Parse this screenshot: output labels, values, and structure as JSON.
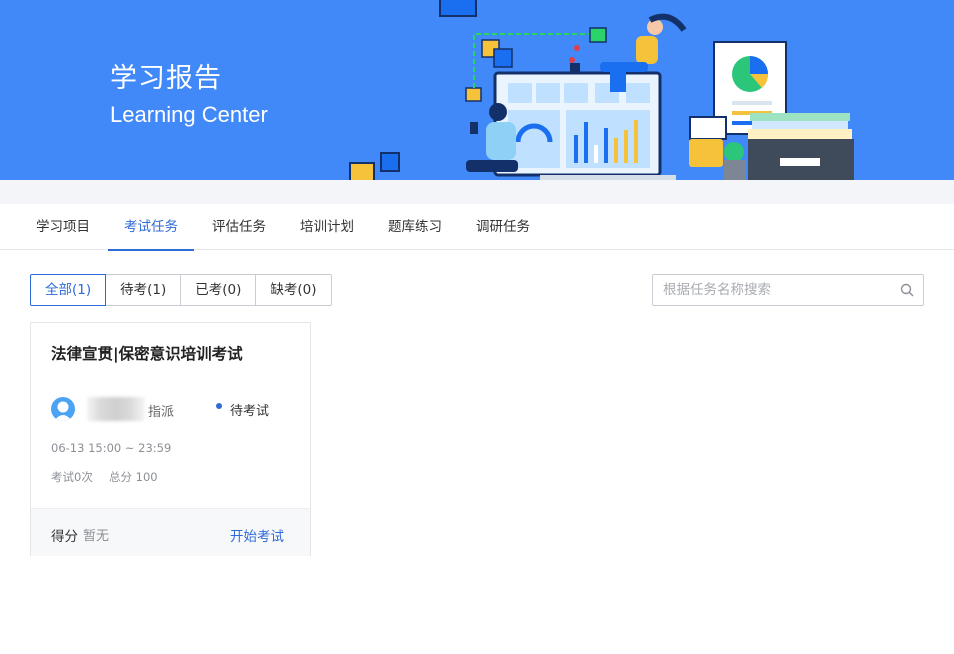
{
  "banner": {
    "title": "学习报告",
    "subtitle": "Learning Center"
  },
  "tabs": [
    {
      "label": "学习项目",
      "active": false
    },
    {
      "label": "考试任务",
      "active": true
    },
    {
      "label": "评估任务",
      "active": false
    },
    {
      "label": "培训计划",
      "active": false
    },
    {
      "label": "题库练习",
      "active": false
    },
    {
      "label": "调研任务",
      "active": false
    }
  ],
  "filters": [
    {
      "label": "全部(1)",
      "active": true
    },
    {
      "label": "待考(1)",
      "active": false
    },
    {
      "label": "已考(0)",
      "active": false
    },
    {
      "label": "缺考(0)",
      "active": false
    }
  ],
  "search": {
    "placeholder": "根据任务名称搜索",
    "value": "",
    "icon": "search-icon"
  },
  "card": {
    "title": "法律宣贯|保密意识培训考试",
    "assigned_label": "指派",
    "status": "待考试",
    "time": "06-13 15:00 ~ 23:59",
    "attempts": "考试0次",
    "total": "总分 100",
    "score_label": "得分",
    "score_value": "暂无",
    "start_label": "开始考试"
  },
  "colors": {
    "banner": "#4189f8",
    "accent": "#2f6bd6",
    "avatar": "#4da3f3"
  }
}
